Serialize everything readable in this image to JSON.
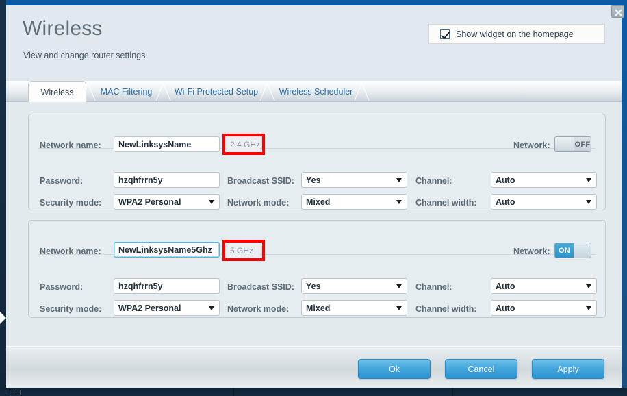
{
  "window": {
    "close_label": "close-icon"
  },
  "header": {
    "title": "Wireless",
    "subtitle": "View and change router settings",
    "widget_checkbox_label": "Show widget on the homepage",
    "widget_checkbox_checked": "true"
  },
  "tabs": [
    {
      "label": "Wireless",
      "active": "true"
    },
    {
      "label": "MAC Filtering",
      "active": "false"
    },
    {
      "label": "Wi-Fi Protected Setup",
      "active": "false"
    },
    {
      "label": "Wireless Scheduler",
      "active": "false"
    }
  ],
  "panels": [
    {
      "network_name_label": "Network name:",
      "network_name_value": "NewLinksysName",
      "band": "2.4 GHz",
      "band_highlighted": "true",
      "password_label": "Password:",
      "password_value": "hzqhfrrn5y",
      "security_mode_label": "Security mode:",
      "security_mode_value": "WPA2 Personal",
      "broadcast_ssid_label": "Broadcast SSID:",
      "broadcast_ssid_value": "Yes",
      "network_mode_label": "Network mode:",
      "network_mode_value": "Mixed",
      "channel_label": "Channel:",
      "channel_value": "Auto",
      "channel_width_label": "Channel width:",
      "channel_width_value": "Auto",
      "network_toggle_label": "Network:",
      "network_toggle_state": "OFF"
    },
    {
      "network_name_label": "Network name:",
      "network_name_value": "NewLinksysName5Ghz",
      "band": "5 GHz",
      "band_highlighted": "true",
      "password_label": "Password:",
      "password_value": "hzqhfrrn5y",
      "security_mode_label": "Security mode:",
      "security_mode_value": "WPA2 Personal",
      "broadcast_ssid_label": "Broadcast SSID:",
      "broadcast_ssid_value": "Yes",
      "network_mode_label": "Network mode:",
      "network_mode_value": "Mixed",
      "channel_label": "Channel:",
      "channel_value": "Auto",
      "channel_width_label": "Channel width:",
      "channel_width_value": "Auto",
      "network_toggle_label": "Network:",
      "network_toggle_state": "ON"
    }
  ],
  "footer": {
    "ok_label": "Ok",
    "cancel_label": "Cancel",
    "apply_label": "Apply"
  },
  "colors": {
    "accent_blue": "#2d93cf",
    "title_bar_blue": "#0b5ca8",
    "highlight_red": "#fe0000",
    "panel_bg": "#e6edf0"
  }
}
